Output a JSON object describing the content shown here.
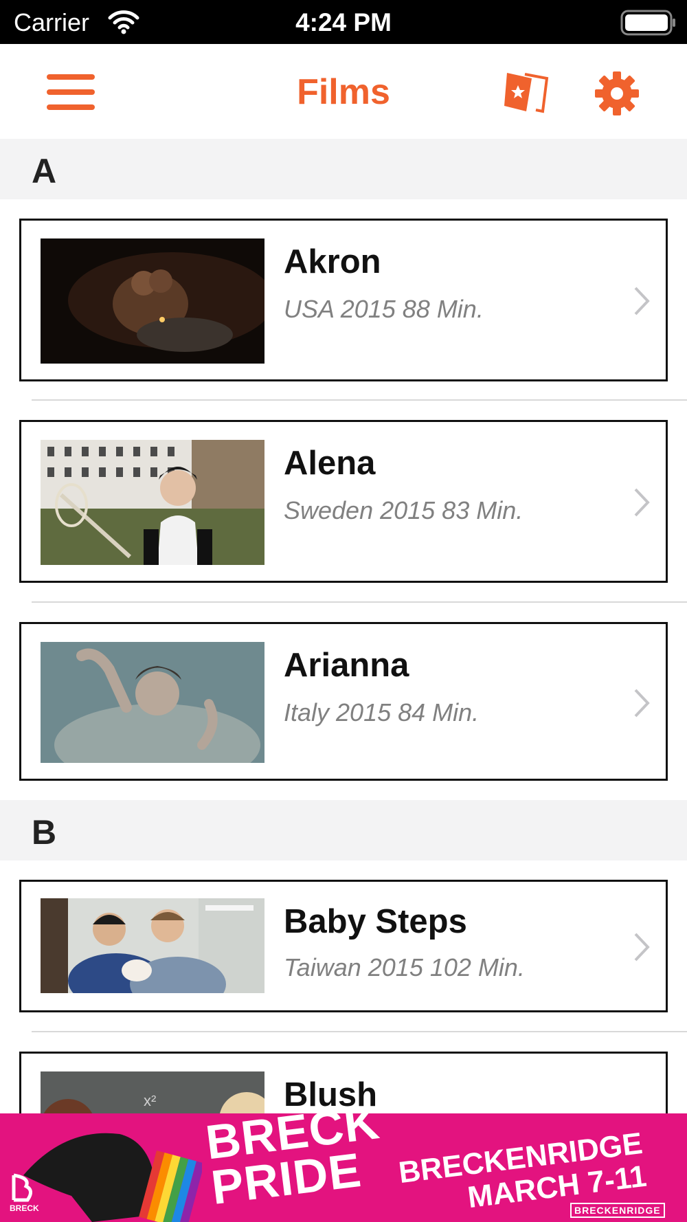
{
  "status_bar": {
    "carrier": "Carrier",
    "time": "4:24 PM"
  },
  "nav": {
    "title": "Films",
    "accent_color": "#f0622d",
    "icons": [
      "menu-icon",
      "tickets-icon",
      "gear-icon"
    ]
  },
  "sections": [
    {
      "letter": "A",
      "films": [
        {
          "title": "Akron",
          "meta": "USA 2015 88 Min."
        },
        {
          "title": "Alena",
          "meta": "Sweden 2015 83 Min."
        },
        {
          "title": "Arianna",
          "meta": "Italy 2015 84 Min."
        }
      ]
    },
    {
      "letter": "B",
      "films": [
        {
          "title": "Baby Steps",
          "meta": "Taiwan 2015 102 Min."
        },
        {
          "title": "Blush",
          "meta": ""
        }
      ]
    }
  ],
  "ad": {
    "headline_line1": "BRECK",
    "headline_line2": "PRIDE",
    "side_line1": "BRECKENRIDGE",
    "side_line2": "MARCH 7-11",
    "logo_text": "BRECK",
    "small_text": "BRECKENRIDGE",
    "background": "#e3137f"
  }
}
